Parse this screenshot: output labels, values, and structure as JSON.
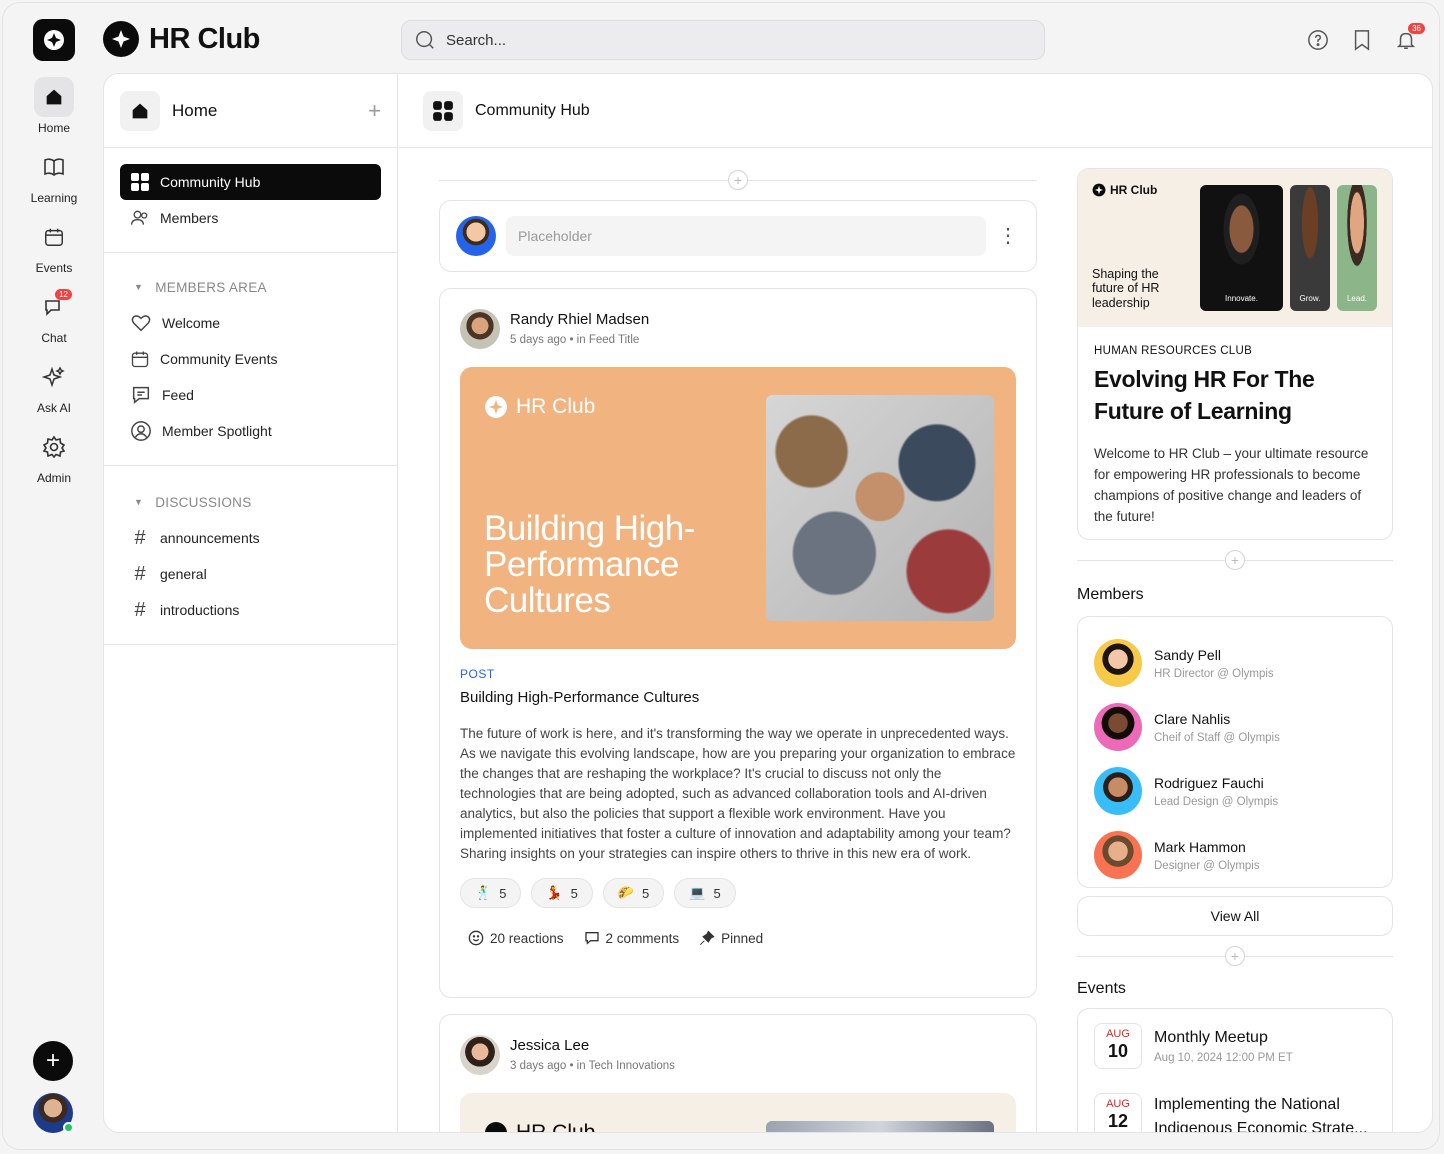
{
  "app": {
    "name": "HR Club"
  },
  "rail": {
    "items": [
      {
        "label": "Home",
        "icon": "home-icon"
      },
      {
        "label": "Learning",
        "icon": "book-icon"
      },
      {
        "label": "Events",
        "icon": "calendar-icon"
      },
      {
        "label": "Chat",
        "icon": "chat-icon",
        "badge": "12"
      },
      {
        "label": "Ask AI",
        "icon": "sparkle-icon"
      },
      {
        "label": "Admin",
        "icon": "gear-icon"
      }
    ]
  },
  "header": {
    "search_placeholder": "Search...",
    "notifications": "36"
  },
  "sidebar": {
    "title": "Home",
    "main_items": [
      {
        "label": "Community Hub",
        "icon": "grid-icon"
      },
      {
        "label": "Members",
        "icon": "users-icon"
      }
    ],
    "members_area": {
      "title": "MEMBERS AREA",
      "items": [
        {
          "label": "Welcome",
          "icon": "heart-icon"
        },
        {
          "label": "Community Events",
          "icon": "calendar-icon"
        },
        {
          "label": "Feed",
          "icon": "message-icon"
        },
        {
          "label": "Member Spotlight",
          "icon": "user-circle-icon"
        }
      ]
    },
    "discussions": {
      "title": "DISCUSSIONS",
      "items": [
        {
          "label": "announcements"
        },
        {
          "label": "general"
        },
        {
          "label": "introductions"
        }
      ]
    }
  },
  "content": {
    "title": "Community Hub",
    "composer": {
      "placeholder": "Placeholder"
    },
    "post": {
      "author": "Randy Rhiel Madsen",
      "meta": "5 days ago • in Feed Title",
      "banner_brand": "HR Club",
      "banner_title": "Building High-Performance Cultures",
      "type": "POST",
      "title": "Building High-Performance Cultures",
      "body": "The future of work is here, and it's transforming the way we operate in unprecedented ways. As we navigate this evolving landscape, how are you preparing your organization to embrace the changes that are reshaping the workplace? It's crucial to discuss not only the technologies that are being adopted, such as advanced collaboration tools and AI-driven analytics, but also the policies that support a flexible work environment. Have you implemented initiatives that foster a culture of innovation and adaptability among your team? Sharing insights on your strategies can inspire others to thrive in this new era of work.",
      "reactions": [
        {
          "emoji": "🕺",
          "count": "5"
        },
        {
          "emoji": "💃",
          "count": "5"
        },
        {
          "emoji": "🌮",
          "count": "5"
        },
        {
          "emoji": "💻",
          "count": "5"
        }
      ],
      "reactions_label": "20 reactions",
      "comments_label": "2 comments",
      "pinned_label": "Pinned"
    },
    "post2": {
      "author": "Jessica Lee",
      "meta": "3 days ago • in Tech Innovations",
      "banner_brand": "HR Club"
    }
  },
  "right": {
    "promo": {
      "brand": "HR Club",
      "tagline": "Shaping the future of HR leadership",
      "tiles": [
        "Innovate.",
        "Grow.",
        "Lead."
      ],
      "kicker": "HUMAN RESOURCES CLUB",
      "title": "Evolving HR For The Future of Learning",
      "text": "Welcome to HR Club – your ultimate resource for empowering HR professionals to become champions of positive change and leaders of the future!"
    },
    "members": {
      "title": "Members",
      "items": [
        {
          "name": "Sandy Pell",
          "role": "HR Director  @ Olympis",
          "color": "#f7c948"
        },
        {
          "name": "Clare Nahlis",
          "role": "Cheif of Staff @ Olympis",
          "color": "#ec6ab8"
        },
        {
          "name": "Rodriguez Fauchi",
          "role": "Lead Design @ Olympis",
          "color": "#38bdf8"
        },
        {
          "name": "Mark Hammon",
          "role": "Designer @ Olympis",
          "color": "#f97352"
        }
      ],
      "view_all": "View All"
    },
    "events": {
      "title": "Events",
      "items": [
        {
          "month": "AUG",
          "day": "10",
          "title": "Monthly Meetup",
          "sub": "Aug 10, 2024 12:00 PM ET"
        },
        {
          "month": "AUG",
          "day": "12",
          "title": "Implementing the National Indigenous Economic Strate...",
          "sub": ""
        }
      ]
    }
  }
}
